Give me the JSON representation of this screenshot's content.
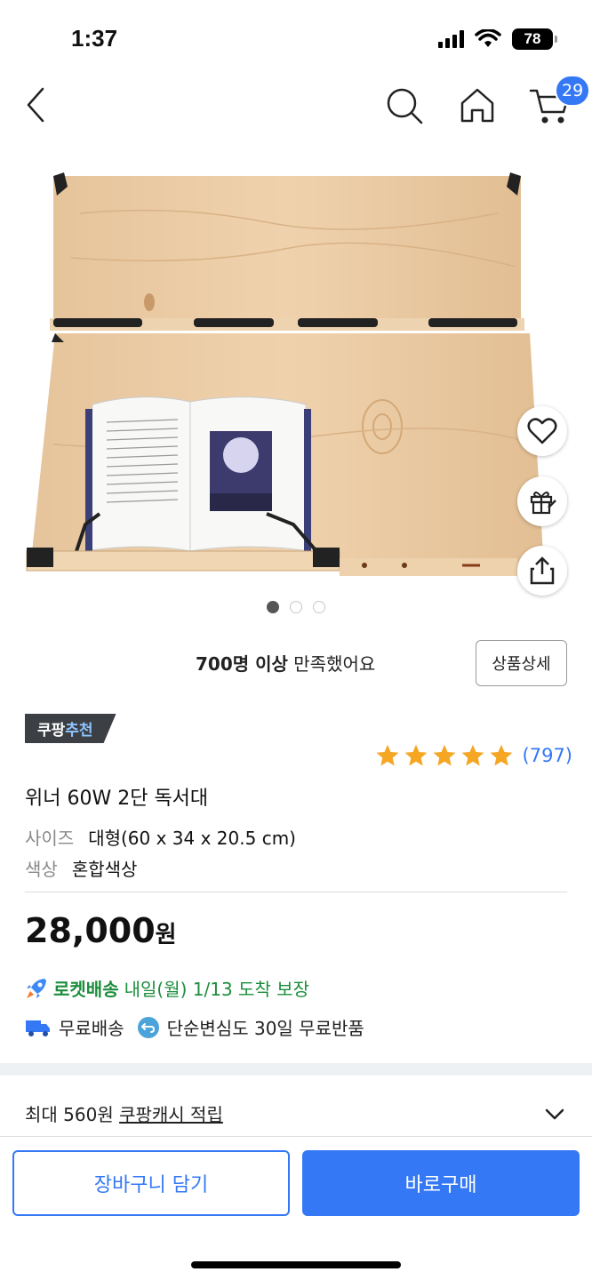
{
  "status": {
    "time": "1:37",
    "battery": "78"
  },
  "nav": {
    "cart_count": "29",
    "icons": [
      "back-icon",
      "search-icon",
      "home-icon",
      "cart-icon"
    ]
  },
  "carousel": {
    "current": 1,
    "total": 3
  },
  "side_actions": [
    "heart-icon",
    "gift-icon",
    "share-icon"
  ],
  "satisfaction": {
    "bold": "700명 이상",
    "rest": " 만족했어요"
  },
  "detail_button": "상품상세",
  "recommend_badge": {
    "prefix": "쿠팡",
    "accent": "추천"
  },
  "rating": {
    "stars": 5,
    "count": "(797)",
    "star_color": "#f5a623"
  },
  "product": {
    "title": "위너 60W 2단 독서대",
    "options": [
      {
        "key": "사이즈",
        "value": "대형(60 x 34 x 20.5 cm)"
      },
      {
        "key": "색상",
        "value": "혼합색상"
      }
    ]
  },
  "price": {
    "amount": "28,000",
    "unit": "원"
  },
  "delivery": {
    "rocket_label": "로켓배송",
    "rocket_text": "내일(월) 1/13 도착 보장",
    "free_shipping": "무료배송",
    "free_return": "단순변심도 30일 무료반품"
  },
  "cash": {
    "prefix": "최대 560원 ",
    "link": "쿠팡캐시 적립"
  },
  "buttons": {
    "cart": "장바구니 담기",
    "buy": "바로구매"
  },
  "colors": {
    "accent": "#3478f6",
    "rocket_green": "#1c8d3c"
  }
}
